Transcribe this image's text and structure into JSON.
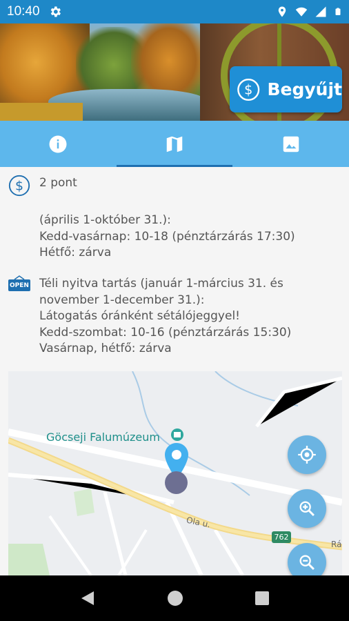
{
  "status": {
    "time": "10:40"
  },
  "hero": {
    "collect_label": "Begyűjt"
  },
  "tabs": [
    {
      "name": "info",
      "icon": "info-icon",
      "active": false
    },
    {
      "name": "map",
      "icon": "map-icon",
      "active": true
    },
    {
      "name": "gallery",
      "icon": "image-icon",
      "active": false
    }
  ],
  "details": {
    "points": "2 pont",
    "summer_hours": "(április 1-október 31.):\nKedd-vasárnap: 10-18 (pénztárzárás 17:30)\nHétfő: zárva",
    "winter_hours": "Téli nyitva tartás (január 1-március 31. és\nnovember 1-december 31.):\nLátogatás óránként sétálójeggyel!\nKedd-szombat: 10-16 (pénztárzárás 15:30)\nVasárnap, hétfő: zárva",
    "open_sign": "OPEN"
  },
  "map": {
    "poi_label": "Göcseji Falumúzeum",
    "street_label": "Ola u.",
    "street_label_2": "Rák",
    "road_number": "762"
  },
  "colors": {
    "status_bar": "#1e88c8",
    "tabs_bg": "#5db7ec",
    "accent": "#1f8fd6",
    "fab": "#6bb4e2"
  }
}
